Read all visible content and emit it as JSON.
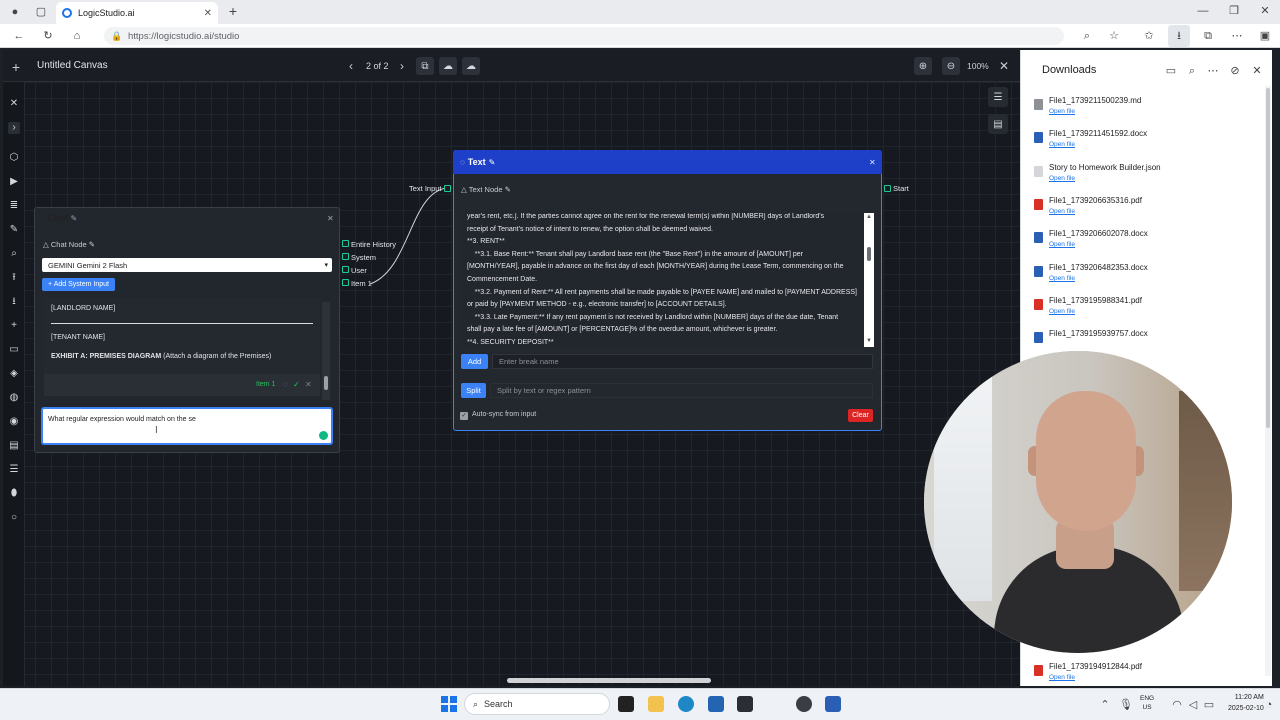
{
  "browser": {
    "tab_title": "LogicStudio.ai",
    "url": "https://logicstudio.ai/studio"
  },
  "toolbar": {
    "canvas_title": "Untitled Canvas",
    "page_indicator": "2 of 2",
    "zoom": "100%"
  },
  "chat_node": {
    "title": "Chat",
    "subtitle": "Chat Node",
    "model": "GEMINI Gemini 2 Flash",
    "add_system_input": "+ Add System Input",
    "log_line1": "[LANDLORD NAME]",
    "log_line2": "[TENANT NAME]",
    "exhibit_bold": "EXHIBIT A: PREMISES DIAGRAM",
    "exhibit_rest": " (Attach a diagram of the Premises)",
    "item_label": "Item 1",
    "input_value": "What regular expression would match on the se"
  },
  "ports": {
    "entire_history": "Entire History",
    "system": "System",
    "user": "User",
    "item1": "Item 1",
    "text_input": "Text Input",
    "start": "Start"
  },
  "text_node": {
    "title": "Text",
    "subtitle": "Text Node",
    "lines": [
      "year's rent, etc.]. If the parties cannot agree on the rent for the renewal term(s) within [NUMBER] days of Landlord's",
      "receipt of Tenant's notice of intent to renew, the option shall be deemed waived.",
      "**3. RENT**",
      "    **3.1. Base Rent:** Tenant shall pay Landlord base rent (the \"Base Rent\") in the amount of [AMOUNT] per",
      "[MONTH/YEAR], payable in advance on the first day of each [MONTH/YEAR] during the Lease Term, commencing on the",
      "Commencement Date.",
      "    **3.2. Payment of Rent:** All rent payments shall be made payable to [PAYEE NAME] and mailed to [PAYMENT ADDRESS]",
      "or paid by [PAYMENT METHOD - e.g., electronic transfer] to [ACCOUNT DETAILS].",
      "    **3.3. Late Payment:** If any rent payment is not received by Landlord within [NUMBER] days of the due date, Tenant",
      "shall pay a late fee of [AMOUNT] or [PERCENTAGE]% of the overdue amount, whichever is greater.",
      "**4. SECURITY DEPOSIT**"
    ],
    "add_label": "Add",
    "break_placeholder": "Enter break name",
    "split_label": "Split",
    "split_placeholder": "Split by text or regex pattern",
    "autosync_label": "Auto-sync from input",
    "clear_label": "Clear"
  },
  "downloads": {
    "title": "Downloads",
    "open_label": "Open file",
    "items": [
      {
        "name": "File1_1739211500239.md",
        "kind": "md"
      },
      {
        "name": "File1_1739211451592.docx",
        "kind": "docx"
      },
      {
        "name": "Story to Homework Builder.json",
        "kind": "json"
      },
      {
        "name": "File1_1739206635316.pdf",
        "kind": "pdf"
      },
      {
        "name": "File1_1739206602078.docx",
        "kind": "docx"
      },
      {
        "name": "File1_1739206482353.docx",
        "kind": "docx"
      },
      {
        "name": "File1_1739195988341.pdf",
        "kind": "pdf"
      },
      {
        "name": "File1_1739195939757.docx",
        "kind": "docx"
      },
      {
        "name": "File1_1739194912844.pdf",
        "kind": "pdf"
      }
    ]
  },
  "taskbar": {
    "search": "Search",
    "lang_top": "ENG",
    "lang_bottom": "US",
    "time": "11:20 AM",
    "date": "2025-02-10"
  },
  "colors": {
    "accent": "#3b82f6",
    "text_node_header": "#1e40c8",
    "port_green": "#20c997",
    "clear_red": "#dc2626"
  }
}
